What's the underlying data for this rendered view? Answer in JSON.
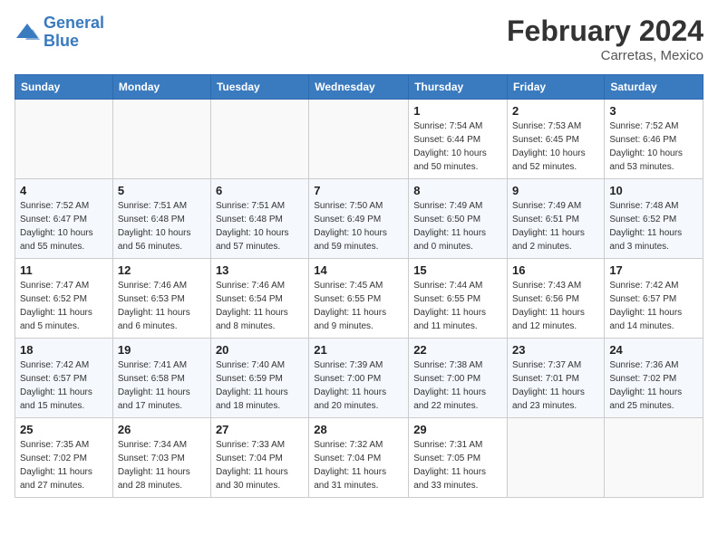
{
  "header": {
    "logo_line1": "General",
    "logo_line2": "Blue",
    "title": "February 2024",
    "subtitle": "Carretas, Mexico"
  },
  "weekdays": [
    "Sunday",
    "Monday",
    "Tuesday",
    "Wednesday",
    "Thursday",
    "Friday",
    "Saturday"
  ],
  "weeks": [
    [
      {
        "num": "",
        "info": ""
      },
      {
        "num": "",
        "info": ""
      },
      {
        "num": "",
        "info": ""
      },
      {
        "num": "",
        "info": ""
      },
      {
        "num": "1",
        "info": "Sunrise: 7:54 AM\nSunset: 6:44 PM\nDaylight: 10 hours\nand 50 minutes."
      },
      {
        "num": "2",
        "info": "Sunrise: 7:53 AM\nSunset: 6:45 PM\nDaylight: 10 hours\nand 52 minutes."
      },
      {
        "num": "3",
        "info": "Sunrise: 7:52 AM\nSunset: 6:46 PM\nDaylight: 10 hours\nand 53 minutes."
      }
    ],
    [
      {
        "num": "4",
        "info": "Sunrise: 7:52 AM\nSunset: 6:47 PM\nDaylight: 10 hours\nand 55 minutes."
      },
      {
        "num": "5",
        "info": "Sunrise: 7:51 AM\nSunset: 6:48 PM\nDaylight: 10 hours\nand 56 minutes."
      },
      {
        "num": "6",
        "info": "Sunrise: 7:51 AM\nSunset: 6:48 PM\nDaylight: 10 hours\nand 57 minutes."
      },
      {
        "num": "7",
        "info": "Sunrise: 7:50 AM\nSunset: 6:49 PM\nDaylight: 10 hours\nand 59 minutes."
      },
      {
        "num": "8",
        "info": "Sunrise: 7:49 AM\nSunset: 6:50 PM\nDaylight: 11 hours\nand 0 minutes."
      },
      {
        "num": "9",
        "info": "Sunrise: 7:49 AM\nSunset: 6:51 PM\nDaylight: 11 hours\nand 2 minutes."
      },
      {
        "num": "10",
        "info": "Sunrise: 7:48 AM\nSunset: 6:52 PM\nDaylight: 11 hours\nand 3 minutes."
      }
    ],
    [
      {
        "num": "11",
        "info": "Sunrise: 7:47 AM\nSunset: 6:52 PM\nDaylight: 11 hours\nand 5 minutes."
      },
      {
        "num": "12",
        "info": "Sunrise: 7:46 AM\nSunset: 6:53 PM\nDaylight: 11 hours\nand 6 minutes."
      },
      {
        "num": "13",
        "info": "Sunrise: 7:46 AM\nSunset: 6:54 PM\nDaylight: 11 hours\nand 8 minutes."
      },
      {
        "num": "14",
        "info": "Sunrise: 7:45 AM\nSunset: 6:55 PM\nDaylight: 11 hours\nand 9 minutes."
      },
      {
        "num": "15",
        "info": "Sunrise: 7:44 AM\nSunset: 6:55 PM\nDaylight: 11 hours\nand 11 minutes."
      },
      {
        "num": "16",
        "info": "Sunrise: 7:43 AM\nSunset: 6:56 PM\nDaylight: 11 hours\nand 12 minutes."
      },
      {
        "num": "17",
        "info": "Sunrise: 7:42 AM\nSunset: 6:57 PM\nDaylight: 11 hours\nand 14 minutes."
      }
    ],
    [
      {
        "num": "18",
        "info": "Sunrise: 7:42 AM\nSunset: 6:57 PM\nDaylight: 11 hours\nand 15 minutes."
      },
      {
        "num": "19",
        "info": "Sunrise: 7:41 AM\nSunset: 6:58 PM\nDaylight: 11 hours\nand 17 minutes."
      },
      {
        "num": "20",
        "info": "Sunrise: 7:40 AM\nSunset: 6:59 PM\nDaylight: 11 hours\nand 18 minutes."
      },
      {
        "num": "21",
        "info": "Sunrise: 7:39 AM\nSunset: 7:00 PM\nDaylight: 11 hours\nand 20 minutes."
      },
      {
        "num": "22",
        "info": "Sunrise: 7:38 AM\nSunset: 7:00 PM\nDaylight: 11 hours\nand 22 minutes."
      },
      {
        "num": "23",
        "info": "Sunrise: 7:37 AM\nSunset: 7:01 PM\nDaylight: 11 hours\nand 23 minutes."
      },
      {
        "num": "24",
        "info": "Sunrise: 7:36 AM\nSunset: 7:02 PM\nDaylight: 11 hours\nand 25 minutes."
      }
    ],
    [
      {
        "num": "25",
        "info": "Sunrise: 7:35 AM\nSunset: 7:02 PM\nDaylight: 11 hours\nand 27 minutes."
      },
      {
        "num": "26",
        "info": "Sunrise: 7:34 AM\nSunset: 7:03 PM\nDaylight: 11 hours\nand 28 minutes."
      },
      {
        "num": "27",
        "info": "Sunrise: 7:33 AM\nSunset: 7:04 PM\nDaylight: 11 hours\nand 30 minutes."
      },
      {
        "num": "28",
        "info": "Sunrise: 7:32 AM\nSunset: 7:04 PM\nDaylight: 11 hours\nand 31 minutes."
      },
      {
        "num": "29",
        "info": "Sunrise: 7:31 AM\nSunset: 7:05 PM\nDaylight: 11 hours\nand 33 minutes."
      },
      {
        "num": "",
        "info": ""
      },
      {
        "num": "",
        "info": ""
      }
    ]
  ]
}
